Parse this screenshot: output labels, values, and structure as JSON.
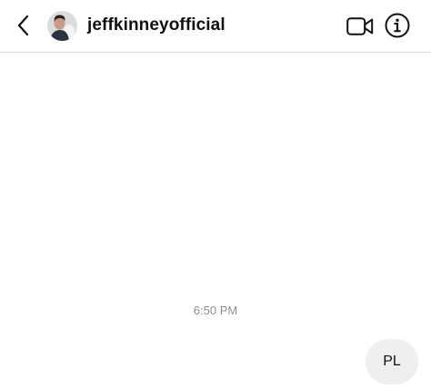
{
  "header": {
    "username": "jeffkinneyofficial",
    "icons": {
      "back": "chevron-left-icon",
      "video_call": "video-camera-icon",
      "info": "info-icon"
    }
  },
  "thread": {
    "timestamp": "6:50 PM",
    "messages": [
      {
        "sender": "me",
        "text": "PL"
      }
    ]
  },
  "colors": {
    "header_border": "#dbdbdb",
    "timestamp_text": "#8e8e8e",
    "bubble_background": "#efefef",
    "text": "#111111"
  }
}
